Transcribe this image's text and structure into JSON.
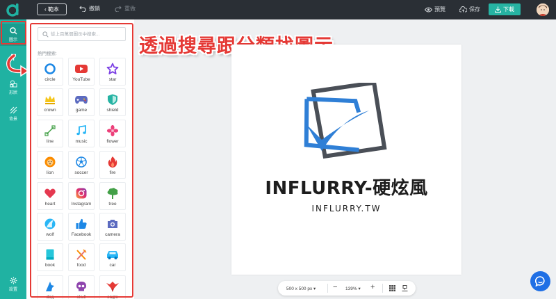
{
  "topbar": {
    "back_label": "範本",
    "undo_label": "撤銷",
    "redo_label": "重做",
    "preview_label": "預覽",
    "save_label": "保存",
    "download_label": "下載"
  },
  "sidebar": {
    "items": [
      {
        "label": "圖示",
        "icon": "search-icon",
        "active": true
      },
      {
        "label": "文字",
        "icon": "text-icon"
      },
      {
        "label": "形狀",
        "icon": "shapes-icon"
      },
      {
        "label": "背景",
        "icon": "background-icon"
      },
      {
        "label": "設置",
        "icon": "settings-icon"
      }
    ]
  },
  "panel": {
    "search_placeholder": "從上百萬個圖示中搜索...",
    "popular_label": "熱門搜索:",
    "icons": [
      {
        "label": "circle",
        "color": "#1e88e5"
      },
      {
        "label": "YouTube",
        "color": "#e53935"
      },
      {
        "label": "star",
        "color": "#7b3fe4"
      },
      {
        "label": "crown",
        "color": "#f5c518"
      },
      {
        "label": "game",
        "color": "#5c6bc0"
      },
      {
        "label": "shield",
        "color": "#26b3a3"
      },
      {
        "label": "line",
        "color": "#43a047"
      },
      {
        "label": "music",
        "color": "#29b6f6"
      },
      {
        "label": "flower",
        "color": "#ec407a"
      },
      {
        "label": "lion",
        "color": "#fb8c00"
      },
      {
        "label": "soccer",
        "color": "#1e88e5"
      },
      {
        "label": "fire",
        "color": "#e53935"
      },
      {
        "label": "heart",
        "color": "#e53950"
      },
      {
        "label": "Instagram",
        "color": "#c13584"
      },
      {
        "label": "tree",
        "color": "#43a047"
      },
      {
        "label": "wolf",
        "color": "#29b6f6"
      },
      {
        "label": "Facebook",
        "color": "#1e88e5"
      },
      {
        "label": "camera",
        "color": "#5c6bc0"
      },
      {
        "label": "book",
        "color": "#26c6da"
      },
      {
        "label": "food",
        "color": "#fb8c00"
      },
      {
        "label": "car",
        "color": "#29b6f6"
      },
      {
        "label": "dog",
        "color": "#1e88e5"
      },
      {
        "label": "skull",
        "color": "#8e44ad"
      },
      {
        "label": "eagle",
        "color": "#e53935"
      }
    ]
  },
  "headline": "透過搜尋跟分類找圖示",
  "canvas": {
    "brand_name": "INFLURRY-硬炫風",
    "domain": "INFLURRY.TW"
  },
  "zoom": {
    "size": "500 x 500 px",
    "level": "139%"
  },
  "colors": {
    "accent": "#20b2a2",
    "highlight": "#e53935",
    "logo_blue": "#2f7fd6",
    "logo_gray": "#4a4f57"
  }
}
